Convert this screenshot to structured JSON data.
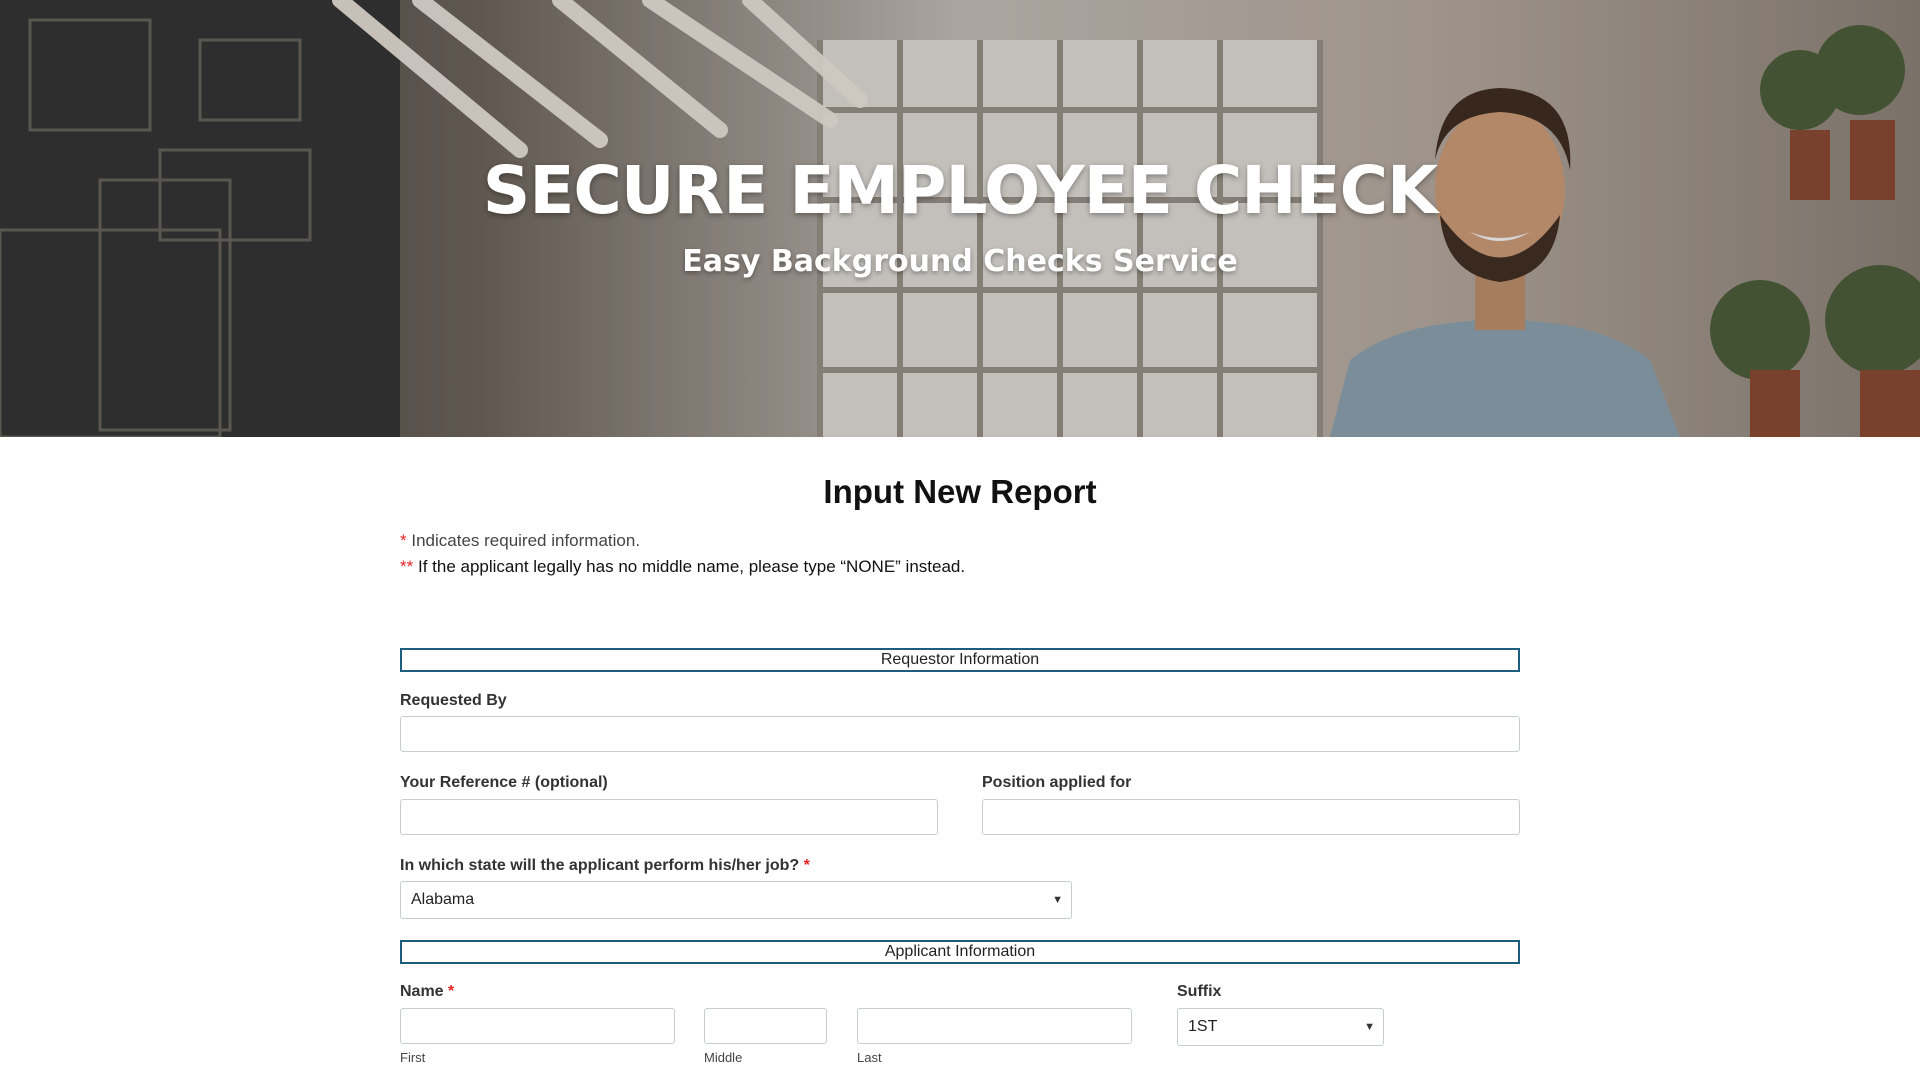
{
  "hero": {
    "title": "SECURE EMPLOYEE CHECK",
    "subtitle": "Easy Background Checks Service"
  },
  "form": {
    "title": "Input New Report",
    "note_required_marker": "*",
    "note_required_text": "Indicates required information.",
    "note_middle_marker": "**",
    "note_middle_text": "If the applicant legally has no middle name, please type “NONE” instead.",
    "sections": {
      "requestor": "Requestor Information",
      "applicant": "Applicant Information"
    },
    "fields": {
      "requested_by": {
        "label": "Requested By",
        "value": ""
      },
      "reference": {
        "label": "Your Reference # (optional)",
        "value": ""
      },
      "position": {
        "label": "Position applied for",
        "value": ""
      },
      "state": {
        "label": "In which state will the applicant perform his/her job?",
        "required_marker": "*",
        "selected": "Alabama"
      },
      "name": {
        "label": "Name",
        "required_marker": "*",
        "first_label": "First",
        "middle_label": "Middle",
        "last_label": "Last"
      },
      "suffix": {
        "label": "Suffix",
        "selected": "1ST"
      }
    }
  },
  "icons": {
    "dropdown": "chevron-down-icon"
  },
  "colors": {
    "section_border": "#1f5b7a",
    "required": "#e02424"
  }
}
